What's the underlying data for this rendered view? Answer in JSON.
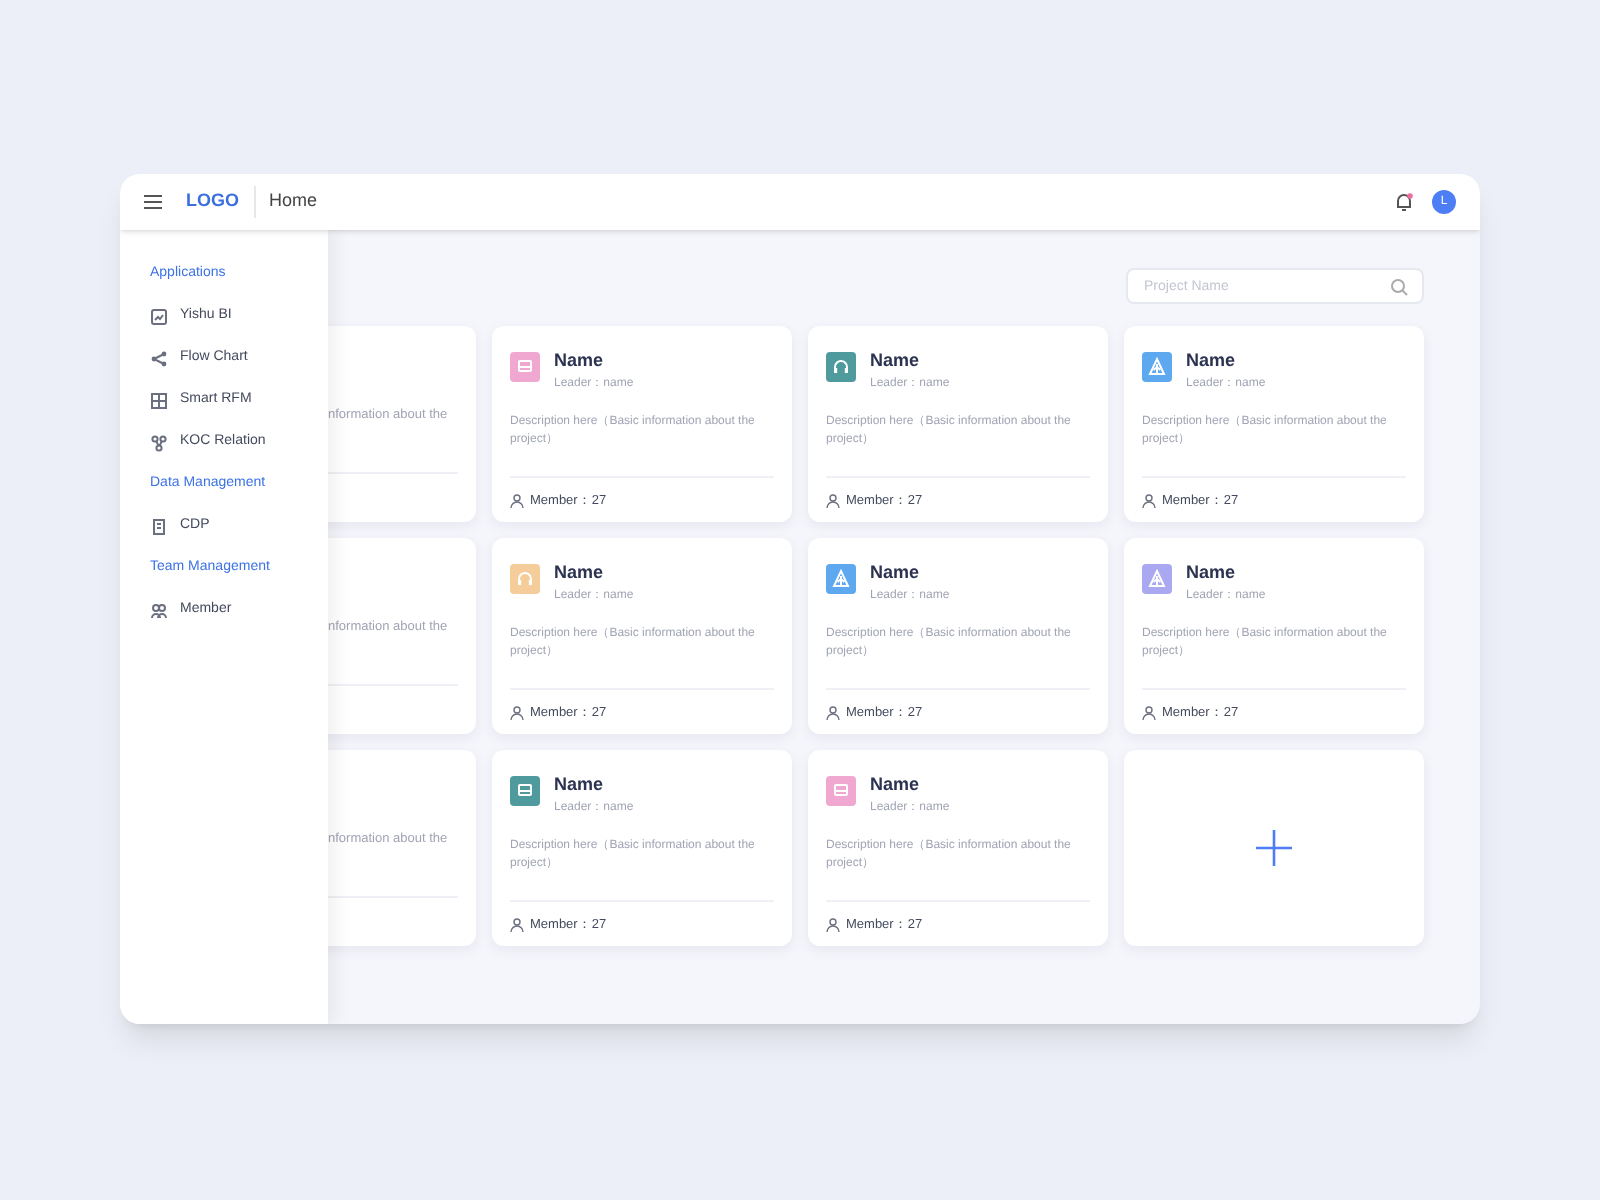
{
  "header": {
    "logo": "LOGO",
    "title": "Home",
    "avatar": "L"
  },
  "sidebar": {
    "sections": [
      {
        "title": "Applications",
        "items": [
          {
            "label": "Yishu BI",
            "kind": "chart"
          },
          {
            "label": "Flow Chart",
            "kind": "share"
          },
          {
            "label": "Smart RFM",
            "kind": "grid"
          },
          {
            "label": "KOC Relation",
            "kind": "nodes"
          }
        ]
      },
      {
        "title": "Data Management",
        "items": [
          {
            "label": "CDP",
            "kind": "doc"
          }
        ]
      },
      {
        "title": "Team Management",
        "items": [
          {
            "label": "Member",
            "kind": "people"
          }
        ]
      }
    ]
  },
  "search": {
    "placeholder": "Project Name"
  },
  "cards": [
    {
      "kind": "covered",
      "description": "nformation about the"
    },
    {
      "kind": "monitor",
      "color": "#f0a8d0",
      "name": "Name",
      "leader": "Leader：name",
      "description": "Description here（Basic information about the project）",
      "member": "Member：27"
    },
    {
      "kind": "headphones",
      "color": "#4f9a9c",
      "name": "Name",
      "leader": "Leader：name",
      "description": "Description here（Basic information about the project）",
      "member": "Member：27"
    },
    {
      "kind": "tree",
      "color": "#5ea8f0",
      "name": "Name",
      "leader": "Leader：name",
      "description": "Description here（Basic information about the project）",
      "member": "Member：27"
    },
    {
      "kind": "covered",
      "description": "nformation about the"
    },
    {
      "kind": "headphones",
      "color": "#f4cd9a",
      "name": "Name",
      "leader": "Leader：name",
      "description": "Description here（Basic information about the project）",
      "member": "Member：27"
    },
    {
      "kind": "tree",
      "color": "#5ea8f0",
      "name": "Name",
      "leader": "Leader：name",
      "description": "Description here（Basic information about the project）",
      "member": "Member：27"
    },
    {
      "kind": "tree",
      "color": "#a9a8f0",
      "name": "Name",
      "leader": "Leader：name",
      "description": "Description here（Basic information about the project）",
      "member": "Member：27"
    },
    {
      "kind": "covered",
      "description": "nformation about the"
    },
    {
      "kind": "monitor",
      "color": "#4f9a9c",
      "name": "Name",
      "leader": "Leader：name",
      "description": "Description here（Basic information about the project）",
      "member": "Member：27"
    },
    {
      "kind": "monitor",
      "color": "#f0a8d0",
      "name": "Name",
      "leader": "Leader：name",
      "description": "Description here（Basic information about the project）",
      "member": "Member：27"
    },
    {
      "kind": "add"
    }
  ]
}
